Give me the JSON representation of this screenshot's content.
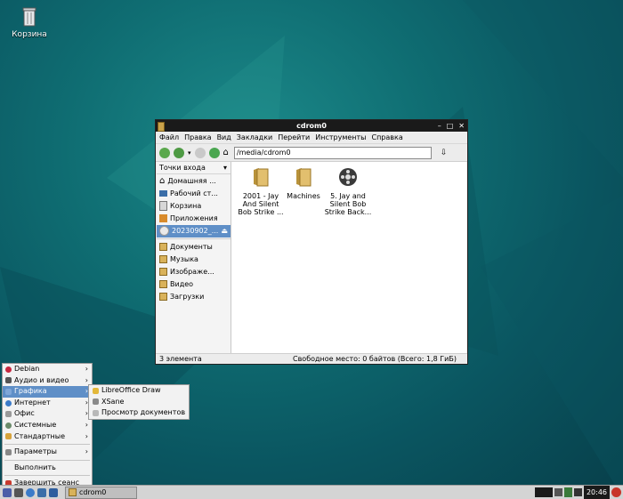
{
  "desktop": {
    "trash_label": "Корзина"
  },
  "window": {
    "title": "cdrom0",
    "menu": [
      "Файл",
      "Правка",
      "Вид",
      "Закладки",
      "Перейти",
      "Инструменты",
      "Справка"
    ],
    "address": "/media/cdrom0",
    "sidebar_header": "Точки входа",
    "places": [
      "Домашняя ...",
      "Рабочий ст...",
      "Корзина",
      "Приложения",
      "20230902_..."
    ],
    "bookmarks": [
      "Документы",
      "Музыка",
      "Изображе...",
      "Видео",
      "Загрузки"
    ],
    "files": [
      {
        "name": "2001 - Jay And Silent Bob Strike ...",
        "icon": "folder-icon"
      },
      {
        "name": "Machines",
        "icon": "folder-icon"
      },
      {
        "name": "5. Jay and Silent Bob Strike Back...",
        "icon": "film-reel-icon"
      }
    ],
    "status_count": "3 элемента",
    "status_free": "Свободное место: 0 байтов (Всего: 1,8 ГиБ)"
  },
  "start_menu": {
    "items": [
      "Debian",
      "Аудио и видео",
      "Графика",
      "Интернет",
      "Офис",
      "Системные",
      "Стандартные"
    ],
    "settings": "Параметры",
    "run": "Выполнить",
    "logout": "Завершить сеанс",
    "selected": "Графика"
  },
  "submenu": [
    "LibreOffice Draw",
    "XSane",
    "Просмотр документов"
  ],
  "taskbar": {
    "task_label": "cdrom0",
    "clock": "20:46"
  },
  "colors": {
    "desktop": "#0f6d72",
    "selection": "#5f8fc7",
    "titlebar": "#1a1a1a"
  }
}
